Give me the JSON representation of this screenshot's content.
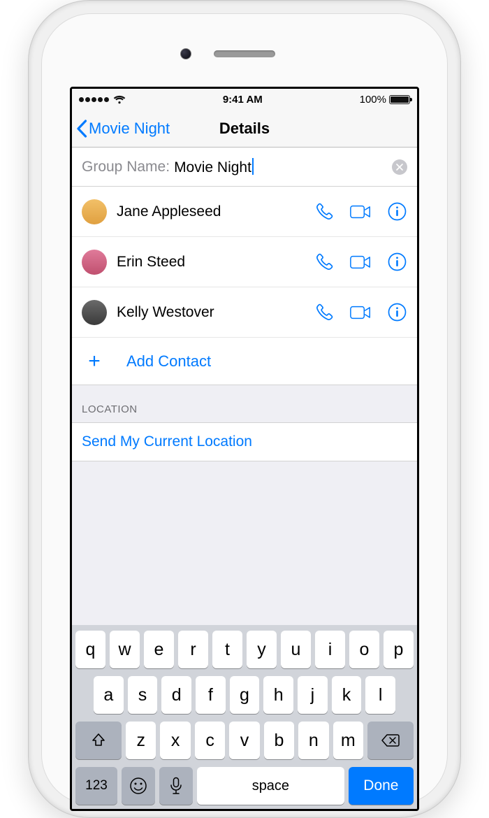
{
  "statusbar": {
    "time": "9:41 AM",
    "battery_pct": "100%"
  },
  "navbar": {
    "back_label": "Movie Night",
    "title": "Details"
  },
  "group": {
    "field_label": "Group Name:",
    "value": "Movie Night"
  },
  "contacts": [
    {
      "name": "Jane Appleseed"
    },
    {
      "name": "Erin Steed"
    },
    {
      "name": "Kelly Westover"
    }
  ],
  "add_contact_label": "Add Contact",
  "section_location": "LOCATION",
  "send_location": "Send My Current Location",
  "keyboard": {
    "row1": [
      "q",
      "w",
      "e",
      "r",
      "t",
      "y",
      "u",
      "i",
      "o",
      "p"
    ],
    "row2": [
      "a",
      "s",
      "d",
      "f",
      "g",
      "h",
      "j",
      "k",
      "l"
    ],
    "row3": [
      "z",
      "x",
      "c",
      "v",
      "b",
      "n",
      "m"
    ],
    "numkey": "123",
    "space": "space",
    "done": "Done"
  }
}
